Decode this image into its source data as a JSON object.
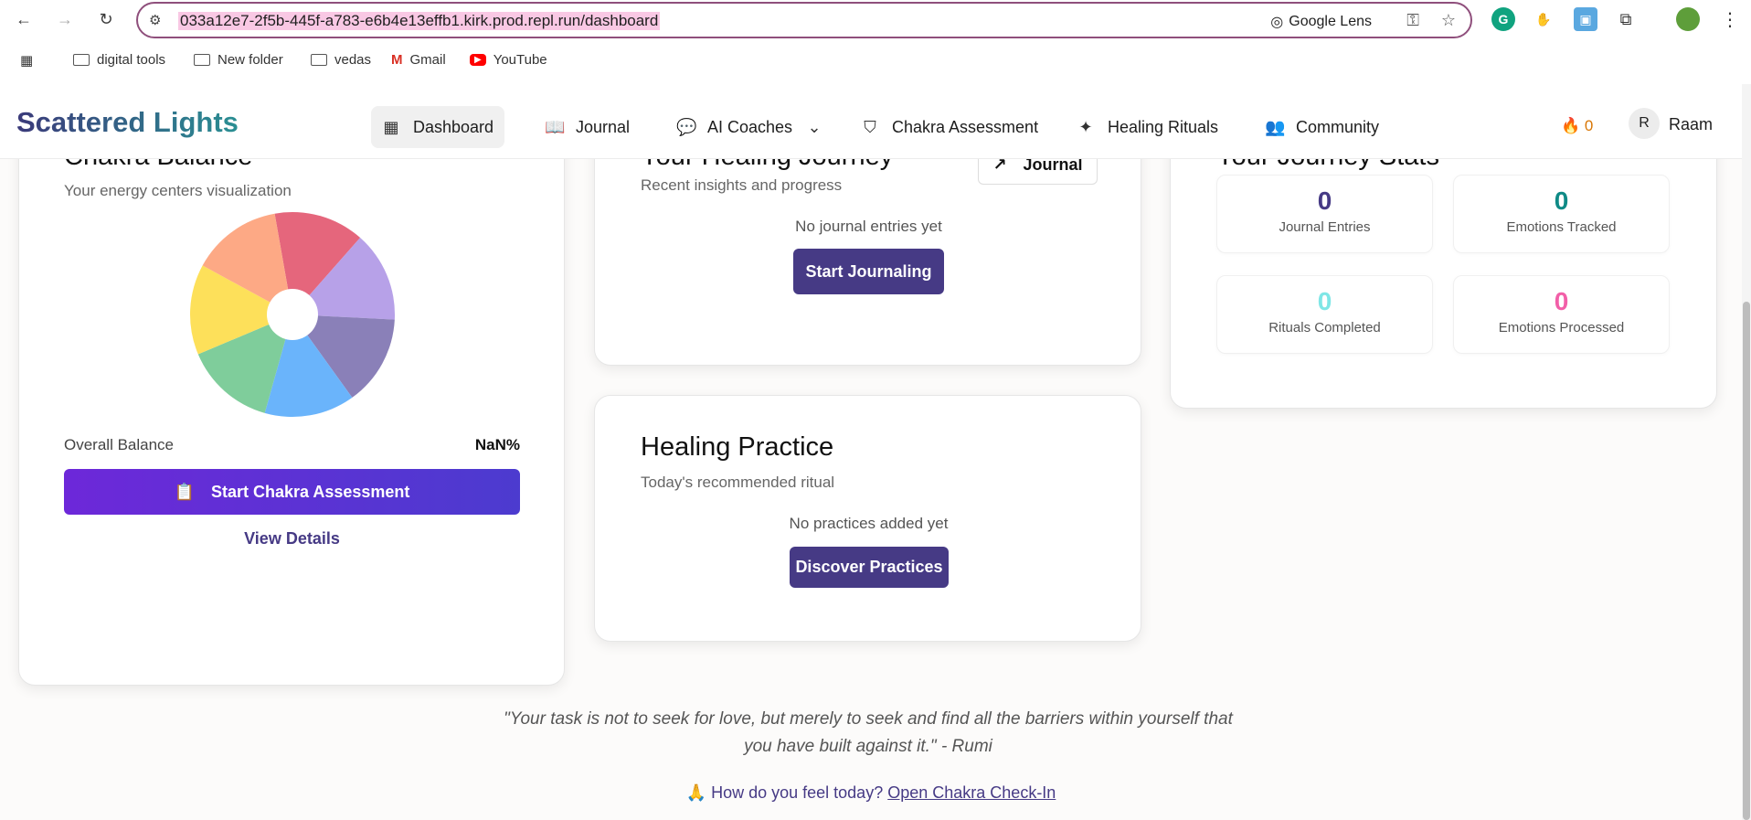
{
  "browser": {
    "url": "033a12e7-2f5b-445f-a783-e6b4e13effb1.kirk.prod.repl.run/dashboard",
    "lens_label": "Google Lens",
    "bookmarks": [
      "digital tools",
      "New folder",
      "vedas",
      "Gmail",
      "YouTube"
    ]
  },
  "app": {
    "brand": "Scattered Lights",
    "nav": [
      {
        "label": "Dashboard",
        "icon": "grid-icon"
      },
      {
        "label": "Journal",
        "icon": "book-icon"
      },
      {
        "label": "AI Coaches",
        "icon": "chat-icon"
      },
      {
        "label": "Chakra Assessment",
        "icon": "shield-icon"
      },
      {
        "label": "Healing Rituals",
        "icon": "sparkles-icon"
      },
      {
        "label": "Community",
        "icon": "users-icon"
      }
    ],
    "streak": "0",
    "user_initial": "R",
    "user_name": "Raam"
  },
  "chakra": {
    "title": "Chakra Balance",
    "subtitle": "Your energy centers visualization",
    "balance_label": "Overall Balance",
    "balance_value": "NaN%",
    "assess_button": "Start Chakra Assessment",
    "details_link": "View Details",
    "segment_colors": [
      "#e5667c",
      "#b7a1e8",
      "#8a80b8",
      "#6ab4fb",
      "#7fcd9b",
      "#fde05a",
      "#fda985"
    ]
  },
  "journey": {
    "title": "Your Healing Journey",
    "subtitle": "Recent insights and progress",
    "journal_button": "Journal",
    "empty": "No journal entries yet",
    "start_button": "Start Journaling"
  },
  "practice": {
    "title": "Healing Practice",
    "subtitle": "Today's recommended ritual",
    "empty": "No practices added yet",
    "discover_button": "Discover Practices"
  },
  "stats": {
    "title": "Your Journey Stats",
    "items": [
      {
        "value": "0",
        "label": "Journal Entries",
        "color": "#463a85"
      },
      {
        "value": "0",
        "label": "Emotions Tracked",
        "color": "#0f8a86"
      },
      {
        "value": "0",
        "label": "Rituals Completed",
        "color": "#7fe6e6"
      },
      {
        "value": "0",
        "label": "Emotions Processed",
        "color": "#f25fa8"
      }
    ]
  },
  "footer": {
    "quote_line1": "\"Your task is not to seek for love, but merely to seek and find all the barriers within yourself that",
    "quote_line2": "you have built against it.\" - Rumi",
    "checkin_prefix": "🙏 How do you feel today?",
    "checkin_link": "Open Chakra Check-In"
  }
}
